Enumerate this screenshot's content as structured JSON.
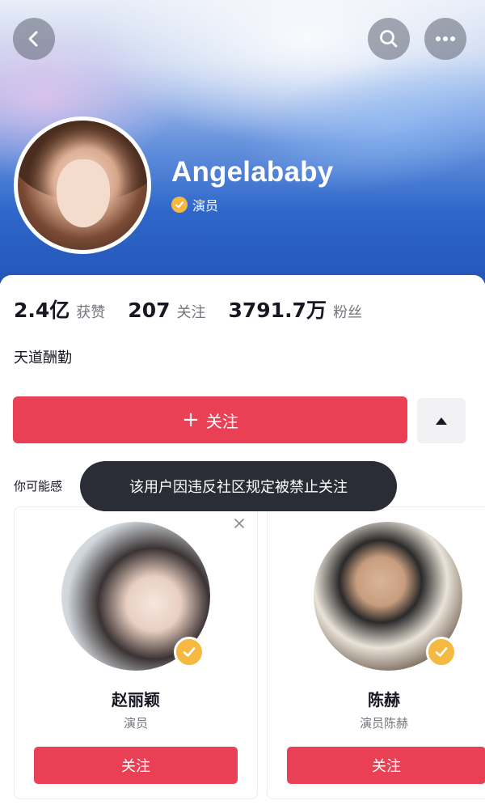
{
  "header": {
    "back_icon": "chevron-left-icon",
    "search_icon": "search-icon",
    "more_icon": "more-horizontal-icon"
  },
  "profile": {
    "username": "Angelababy",
    "verified_label": "演员",
    "verified_badge_color": "#f5b942",
    "bio": "天道酬勤"
  },
  "stats": [
    {
      "value": "2.4亿",
      "label": "获赞"
    },
    {
      "value": "207",
      "label": "关注"
    },
    {
      "value": "3791.7万",
      "label": "粉丝"
    }
  ],
  "actions": {
    "follow_label": "关注",
    "follow_prefix": "+",
    "accent_color": "#ea4055",
    "more_icon": "triangle-up-icon"
  },
  "suggestions": {
    "title": "你可能感",
    "items": [
      {
        "name": "赵丽颖",
        "subtitle": "演员",
        "follow_label": "关注"
      },
      {
        "name": "陈赫",
        "subtitle": "演员陈赫",
        "follow_label": "关注"
      }
    ]
  },
  "toast": {
    "message": "该用户因违反社区规定被禁止关注"
  }
}
